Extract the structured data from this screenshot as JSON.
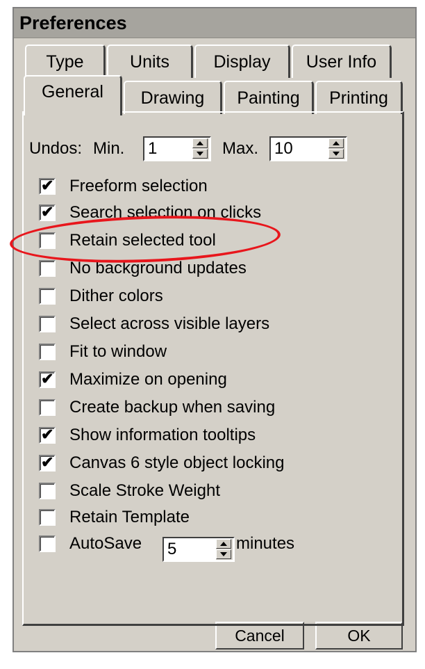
{
  "window": {
    "title": "Preferences"
  },
  "tabs_row1": [
    "Type",
    "Units",
    "Display",
    "User Info"
  ],
  "tabs_row2": [
    "General",
    "Drawing",
    "Painting",
    "Printing"
  ],
  "active_tab": "General",
  "undos": {
    "label": "Undos:",
    "min_label": "Min.",
    "min_value": "1",
    "max_label": "Max.",
    "max_value": "10"
  },
  "options": [
    {
      "label": "Freeform selection",
      "checked": true
    },
    {
      "label": "Search selection on clicks",
      "checked": true
    },
    {
      "label": "Retain selected tool",
      "checked": false
    },
    {
      "label": "No background updates",
      "checked": false
    },
    {
      "label": "Dither colors",
      "checked": false
    },
    {
      "label": "Select across visible layers",
      "checked": false
    },
    {
      "label": "Fit to window",
      "checked": false
    },
    {
      "label": "Maximize on opening",
      "checked": true
    },
    {
      "label": "Create backup when saving",
      "checked": false
    },
    {
      "label": "Show information tooltips",
      "checked": true
    },
    {
      "label": "Canvas 6 style object locking",
      "checked": true
    },
    {
      "label": "Scale Stroke Weight",
      "checked": false
    },
    {
      "label": "Retain Template",
      "checked": false
    }
  ],
  "autosave": {
    "label": "AutoSave",
    "value": "5",
    "unit": "minutes",
    "checked": false
  },
  "buttons": {
    "cancel": "Cancel",
    "ok": "OK"
  },
  "colors": {
    "dialog_bg": "#d4d0c8",
    "title_bar": "#a6a49e",
    "annotation": "#e8161c"
  }
}
